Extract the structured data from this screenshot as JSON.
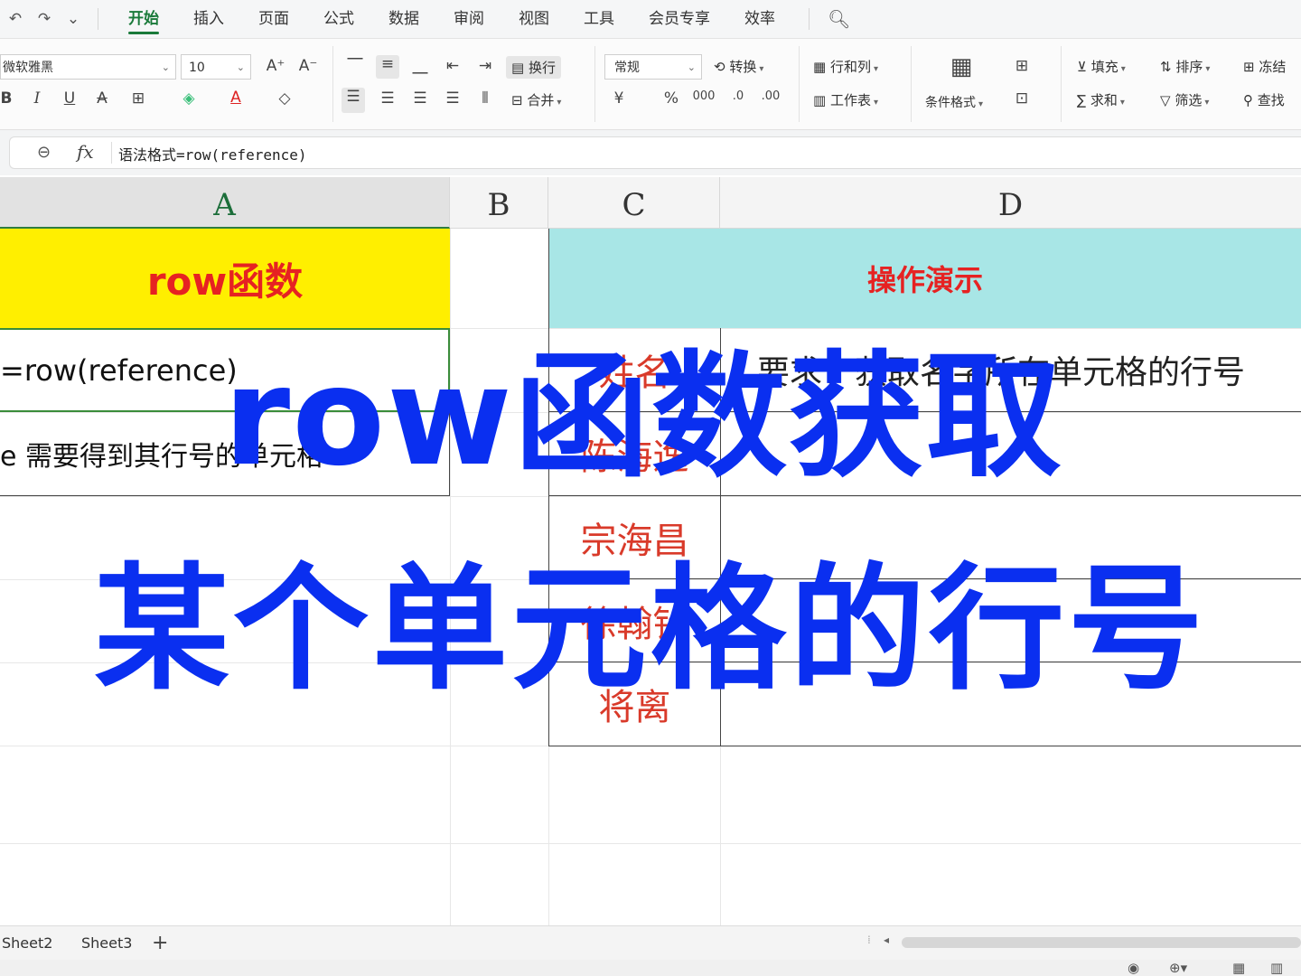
{
  "menubar": {
    "quick_access": [
      "↶",
      "↷",
      "⌄"
    ],
    "tabs": [
      "开始",
      "插入",
      "页面",
      "公式",
      "数据",
      "审阅",
      "视图",
      "工具",
      "会员专享",
      "效率"
    ],
    "active_tab": "开始"
  },
  "ribbon": {
    "font_name": "微软雅黑",
    "font_size": "10",
    "number_format": "常规",
    "wrap_label": "换行",
    "merge_label": "合并",
    "convert_label": "转换",
    "rowcol_label": "行和列",
    "worksheet_label": "工作表",
    "condfmt_label": "条件格式",
    "fill_label": "填充",
    "sort_label": "排序",
    "freeze_label": "冻结",
    "sum_label": "求和",
    "filter_label": "筛选",
    "find_label": "查找"
  },
  "formula_bar": {
    "fx": "fx",
    "content": "语法格式=row(reference)"
  },
  "columns": [
    "A",
    "B",
    "C",
    "D"
  ],
  "cells": {
    "a1": "row函数",
    "a2": "=row(reference)",
    "a3": "e 需要得到其行号的单元格",
    "d1": "操作演示",
    "c2": "姓名",
    "d2": "要求：获取名字所在单元格的行号",
    "names": [
      "陈海逸",
      "宗海昌",
      "徐翰钦",
      "将离"
    ]
  },
  "overlay": {
    "line1": "row函数获取",
    "line2": "某个单元格的行号"
  },
  "sheet_tabs": [
    "Sheet2",
    "Sheet3"
  ],
  "colors": {
    "accent": "#1a7a3a",
    "header_yellow": "#ffef00",
    "header_cyan": "#a8e6e6",
    "red_text": "#e62222",
    "overlay_blue": "#0a2ff0"
  }
}
